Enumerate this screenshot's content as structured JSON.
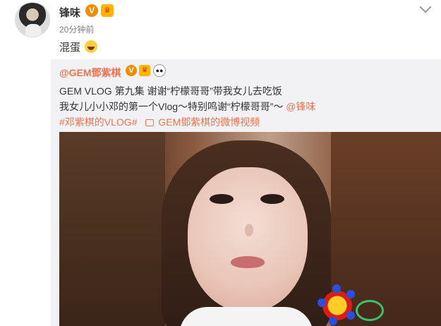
{
  "author": {
    "name": "锋味",
    "verified_mark": "V",
    "time": "20分钟前",
    "post_text": "混蛋"
  },
  "repost": {
    "author": "@GEM鄧紫棋",
    "verified_mark": "V",
    "line1": "GEM VLOG 第九集 谢谢“柠檬哥哥”带我女儿去吃饭",
    "line2_prefix": "我女儿小小邓的第一个Vlog～特别鸣谢“柠檬哥哥”～",
    "line2_mention": "@锋味",
    "topic": "#邓紫棋的VLOG#",
    "video_link": "GEM鄧紫棋的微博视频"
  },
  "colors": {
    "accent": "#eb7350",
    "muted": "#808080",
    "repost_bg": "#f2f2f5",
    "verified": "#f08c00"
  },
  "icons": {
    "verified": "verified-v-icon",
    "crown": "crown-icon",
    "panda": "panda-icon",
    "emoji": "laugh-emoji-icon",
    "video": "video-icon",
    "menu": "chevron-down-icon"
  }
}
